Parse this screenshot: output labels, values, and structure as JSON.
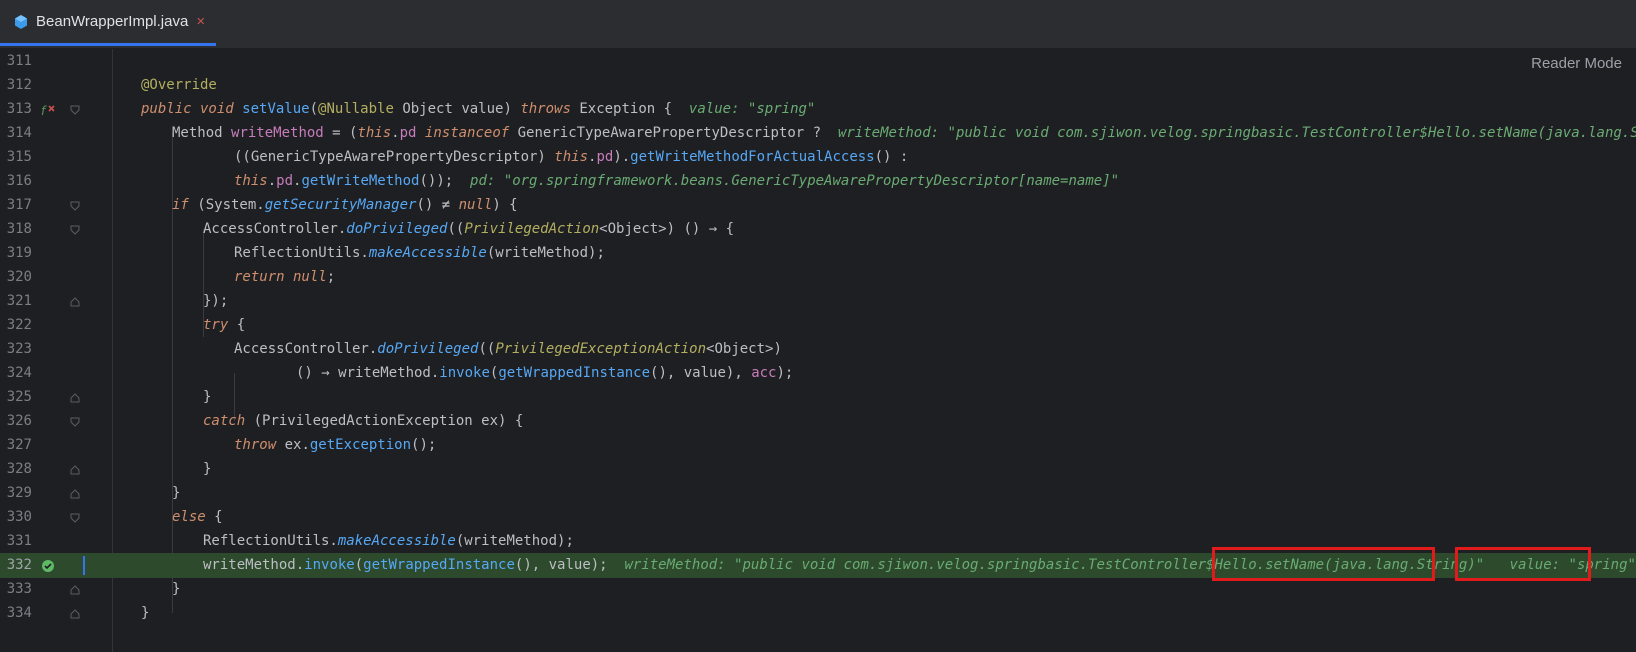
{
  "tab": {
    "filename": "BeanWrapperImpl.java",
    "close": "×"
  },
  "reader_mode": "Reader Mode",
  "lines": [
    {
      "n": "311"
    },
    {
      "n": "312",
      "t": [
        "@Override"
      ]
    },
    {
      "n": "313",
      "t": [
        "public void ",
        "setValue",
        "(",
        "@Nullable",
        " Object value) ",
        "throws",
        " Exception {  ",
        "value: \"spring\""
      ]
    },
    {
      "n": "314",
      "t": [
        "Method ",
        "writeMethod",
        " = (",
        "this",
        ".",
        "pd",
        " ",
        "instanceof",
        " GenericTypeAwarePropertyDescriptor ?  ",
        "writeMethod: \"public void com.sjiwon.velog.springbasic.TestController$Hello.setName(java.lang.String)\""
      ]
    },
    {
      "n": "315",
      "t": [
        "((GenericTypeAwarePropertyDescriptor) ",
        "this",
        ".",
        "pd",
        ").",
        "getWriteMethodForActualAccess",
        "() :"
      ]
    },
    {
      "n": "316",
      "t": [
        "this",
        ".",
        "pd",
        ".",
        "getWriteMethod",
        "());  ",
        "pd: \"org.springframework.beans.GenericTypeAwarePropertyDescriptor[name=name]\""
      ]
    },
    {
      "n": "317",
      "t": [
        "if",
        " (System.",
        "getSecurityManager",
        "() ≠ ",
        "null",
        ") {"
      ]
    },
    {
      "n": "318",
      "t": [
        "AccessController.",
        "doPrivileged",
        "((",
        "PrivilegedAction",
        "<Object>) () → {"
      ]
    },
    {
      "n": "319",
      "t": [
        "ReflectionUtils.",
        "makeAccessible",
        "(writeMethod);"
      ]
    },
    {
      "n": "320",
      "t": [
        "return null",
        ";"
      ]
    },
    {
      "n": "321",
      "t": [
        "});"
      ]
    },
    {
      "n": "322",
      "t": [
        "try",
        " {"
      ]
    },
    {
      "n": "323",
      "t": [
        "AccessController.",
        "doPrivileged",
        "((",
        "PrivilegedExceptionAction",
        "<Object>)"
      ]
    },
    {
      "n": "324",
      "t": [
        "() → writeMethod.",
        "invoke",
        "(",
        "getWrappedInstance",
        "(), value), ",
        "acc",
        ");"
      ]
    },
    {
      "n": "325",
      "t": [
        "}"
      ]
    },
    {
      "n": "326",
      "t": [
        "catch",
        " (PrivilegedActionException ex) {"
      ]
    },
    {
      "n": "327",
      "t": [
        "throw",
        " ex.",
        "getException",
        "();"
      ]
    },
    {
      "n": "328",
      "t": [
        "}"
      ]
    },
    {
      "n": "329",
      "t": [
        "}"
      ]
    },
    {
      "n": "330",
      "t": [
        "else",
        " {"
      ]
    },
    {
      "n": "331",
      "t": [
        "ReflectionUtils.",
        "makeAccessible",
        "(writeMethod);"
      ]
    },
    {
      "n": "332",
      "t": [
        "writeMethod.",
        "invoke",
        "(",
        "getWrappedInstance",
        "(), value);  ",
        "writeMethod: \"public void com.sjiwon.velog.springbasic.TestController$Hello.",
        "setName(java.lang.String)\"",
        "   ",
        "value: \"spring\""
      ]
    },
    {
      "n": "333",
      "t": [
        "}"
      ]
    },
    {
      "n": "334",
      "t": [
        "}"
      ]
    }
  ],
  "colors": {
    "accent": "#3574f0",
    "current_line": "#2d4a2d",
    "highlight_box": "#e11b1b",
    "keyword": "#cf8e6d",
    "method": "#56a8f5",
    "field": "#c77dbb"
  },
  "icons": [
    "java-class-icon",
    "close-icon",
    "override-method-icon",
    "breakpoint-check-icon",
    "fold-icon"
  ]
}
